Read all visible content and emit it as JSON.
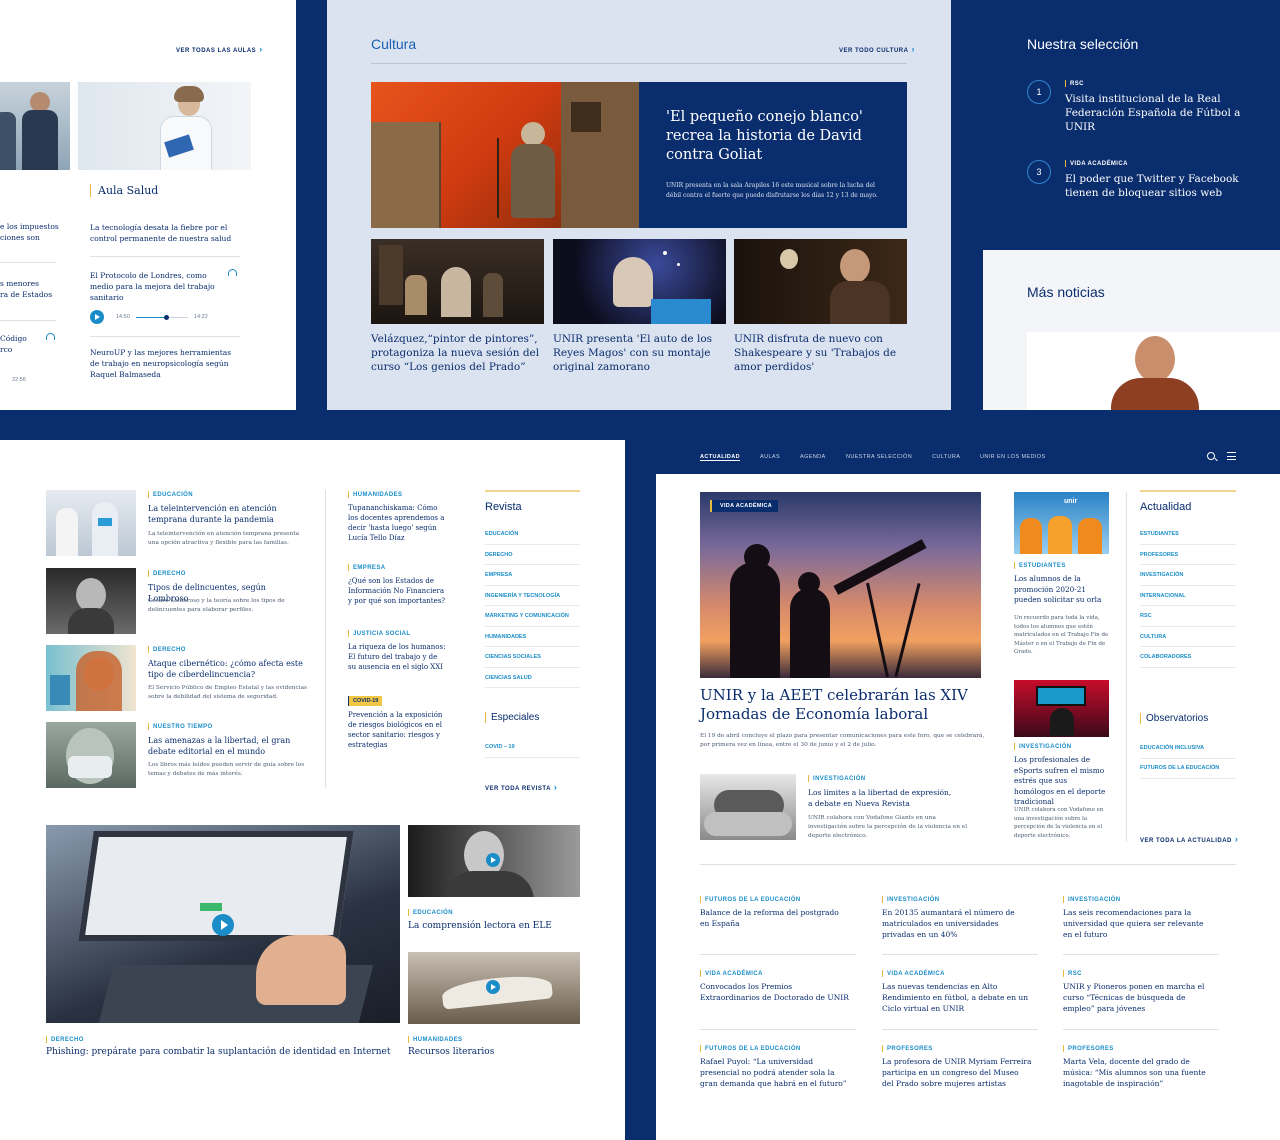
{
  "aulas": {
    "ver_todas": "VER TODAS LAS AULAS",
    "salud_heading": "Aula Salud",
    "left_fragments": [
      "e los impuestos",
      "ciones son",
      "s menores",
      "ra de Estados",
      "Código",
      "rco",
      "22:56"
    ],
    "items": [
      {
        "title": "La tecnología desata la fiebre por el control permanente de nuestra salud"
      },
      {
        "title": "El Protocolo de Londres, como medio para la mejora del trabajo sanitario",
        "time_start": "14:50",
        "time_end": "14:22"
      },
      {
        "title": "NeuroUP y las mejores herramientas de trabajo en neuropsicología según Raquel Balmaseda"
      }
    ]
  },
  "cultura": {
    "heading": "Cultura",
    "ver_todo": "VER TODO CULTURA",
    "feature": {
      "title": "'El pequeño conejo blanco' recrea la historia de David contra Goliat",
      "summary": "UNIR presenta en la sala Arapiles 16 este musical sobre la lucha del débil contra el fuerte que puede disfrutarse los días 12 y 13 de mayo."
    },
    "cards": [
      {
        "title": "Velázquez,“pintor de pintores”, protagoniza la nueva sesión del curso “Los genios del Prado”"
      },
      {
        "title": "UNIR presenta 'El auto de los Reyes Magos' con su montaje original zamorano"
      },
      {
        "title": "UNIR disfruta de nuevo con Shakespeare y su 'Trabajos de amor perdidos'"
      }
    ]
  },
  "seleccion": {
    "heading": "Nuestra selección",
    "items": [
      {
        "num": "1",
        "tag": "RSC",
        "title": "Visita institucional de la Real Federación Española de Fútbol a UNIR"
      },
      {
        "num": "3",
        "tag": "VIDA ACADÉMICA",
        "title": "El poder que Twitter y Facebook tienen de bloquear sitios web"
      }
    ]
  },
  "mas_noticias": {
    "heading": "Más noticias"
  },
  "revista_page": {
    "left_items": [
      {
        "tag": "EDUCACIÓN",
        "title": "La teleintervención en atención temprana durante la pandemia",
        "summary": "La teleintervención en atención temprana presenta una opción atractiva y flexible para las familias."
      },
      {
        "tag": "DERECHO",
        "title": "Tipos de delincuentes, según Lombroso",
        "summary": "Cesare Lombroso y la teoría sobre los tipos de delincuentes para elaborar perfiles."
      },
      {
        "tag": "DERECHO",
        "title": "Ataque cibernético: ¿cómo afecta este tipo de ciberdelincuencia?",
        "summary": "El Servicio Público de Empleo Estatal y las evidencias sobre la debilidad del sistema de seguridad."
      },
      {
        "tag": "NUESTRO TIEMPO",
        "title": "Las amenazas a la libertad, el gran debate editorial en el mundo",
        "summary": "Los libros más leídos pueden servir de guía sobre los temas y debates de más interés."
      }
    ],
    "mid_items": [
      {
        "tag": "HUMANIDADES",
        "title": "Tupananchiskama: Cómo los docentes aprendemos a decir 'hasta luego' según Lucía Tello Díaz"
      },
      {
        "tag": "EMPRESA",
        "title": "¿Qué son los Estados de Información No Financiera y por qué son importantes?"
      },
      {
        "tag": "JUSTICIA SOCIAL",
        "title": "La riqueza de los humanos: El futuro del trabajo y de su ausencia en el siglo XXI"
      },
      {
        "tag": "COVID-19",
        "title": "Prevención a la exposición de riesgos biológicos en el sector sanitario: riesgos y estrategias"
      }
    ],
    "revista_heading": "Revista",
    "revista_links": [
      "EDUCACIÓN",
      "DERECHO",
      "EMPRESA",
      "INGENIERÍA Y TECNOLOGÍA",
      "MARKETING Y COMUNICACIÓN",
      "HUMANIDADES",
      "CIENCIAS SOCIALES",
      "CIENCIAS SALUD"
    ],
    "especiales_heading": "Especiales",
    "especiales_links": [
      "COVID – 19"
    ],
    "ver_toda": "VER TODA REVISTA",
    "videos": [
      {
        "tag": "DERECHO",
        "title": "Phishing: prepárate para combatir la suplantación de identidad en Internet"
      },
      {
        "tag": "EDUCACIÓN",
        "title": "La comprensión lectora en ELE"
      },
      {
        "tag": "HUMANIDADES",
        "title": "Recursos literarios"
      }
    ]
  },
  "actualidad_page": {
    "nav": [
      "ACTUALIDAD",
      "AULAS",
      "AGENDA",
      "NUESTRA SELECCIÓN",
      "CULTURA",
      "UNIR EN LOS MEDIOS"
    ],
    "main": {
      "tag": "VIDA ACADÉMICA",
      "title": "UNIR y la AEET celebrarán las XIV Jornadas de Economía laboral",
      "summary": "El 19 de abril concluye el plazo para presentar comunicaciones para este foro, que se celebrará, por primera vez en línea, entre el 30 de junio y el 2 de julio."
    },
    "secondary": {
      "tag": "INVESTIGACIÓN",
      "title": "Los límites a la libertad de expresión, a debate en Nueva Revista",
      "summary": "UNIR colabora con Vodafone Giants en una investigación sobre la percepción de la violencia en el deporte electrónico."
    },
    "side_items": [
      {
        "tag": "ESTUDIANTES",
        "title": "Los alumnos de la promoción 2020-21 pueden solicitar su orla",
        "summary": "Un recuerdo para toda la vida, todos los alumnos que estén matriculados en el Trabajo Fin de Máster o en el Trabajo de Fin de Grado."
      },
      {
        "tag": "INVESTIGACIÓN",
        "title": "Los profesionales de eSports sufren el mismo estrés que sus homólogos en el deporte tradicional",
        "summary": "UNIR colabora con Vodafone en una investigación sobre la percepción de la violencia en el deporte electrónico."
      }
    ],
    "actualidad_heading": "Actualidad",
    "actualidad_links": [
      "ESTUDIANTES",
      "PROFESORES",
      "INVESTIGACIÓN",
      "INTERNACIONAL",
      "RSC",
      "CULTURA",
      "COLABORADORES"
    ],
    "observatorios_heading": "Observatorios",
    "observatorios_links": [
      "EDUCACIÓN INCLUSIVA",
      "FUTUROS DE LA EDUCACIÓN"
    ],
    "ver_toda": "VER TODA LA ACTUALIDAD",
    "banner_text": "unir",
    "grid": [
      {
        "tag": "FUTUROS DE LA EDUCACIÓN",
        "title": "Balance de la reforma del postgrado en España"
      },
      {
        "tag": "INVESTIGACIÓN",
        "title": "En 20135 aumantará el número de matriculados en universidades privadas en un 40%"
      },
      {
        "tag": "INVESTIGACIÓN",
        "title": "Las seis recomendaciones para la universidad que quiera ser relevante en el futuro"
      },
      {
        "tag": "VIDA ACADÉMICA",
        "title": "Convocados los Premios Extraordinarios de Doctorado de UNIR"
      },
      {
        "tag": "VIDA ACADÉMICA",
        "title": "Las nuevas tendencias en Alto Rendimiento en fútbol, a debate en un Ciclo virtual en UNIR"
      },
      {
        "tag": "RSC",
        "title": "UNIR y Pioneros ponen en marcha el curso “Técnicas de búsqueda de empleo” para jóvenes"
      },
      {
        "tag": "FUTUROS DE LA EDUCACIÓN",
        "title": "Rafael Puyol: “La universidad presencial no podrá atender sola la gran demanda que habrá en el futuro”"
      },
      {
        "tag": "PROFESORES",
        "title": "La profesora de UNIR Myriam Ferreira participa en un congreso del Museo del Prado sobre mujeres artistas"
      },
      {
        "tag": "PROFESORES",
        "title": "Marta Vela, docente del grado de música: “Mis alumnos son una fuente inagotable de inspiración”"
      }
    ]
  }
}
